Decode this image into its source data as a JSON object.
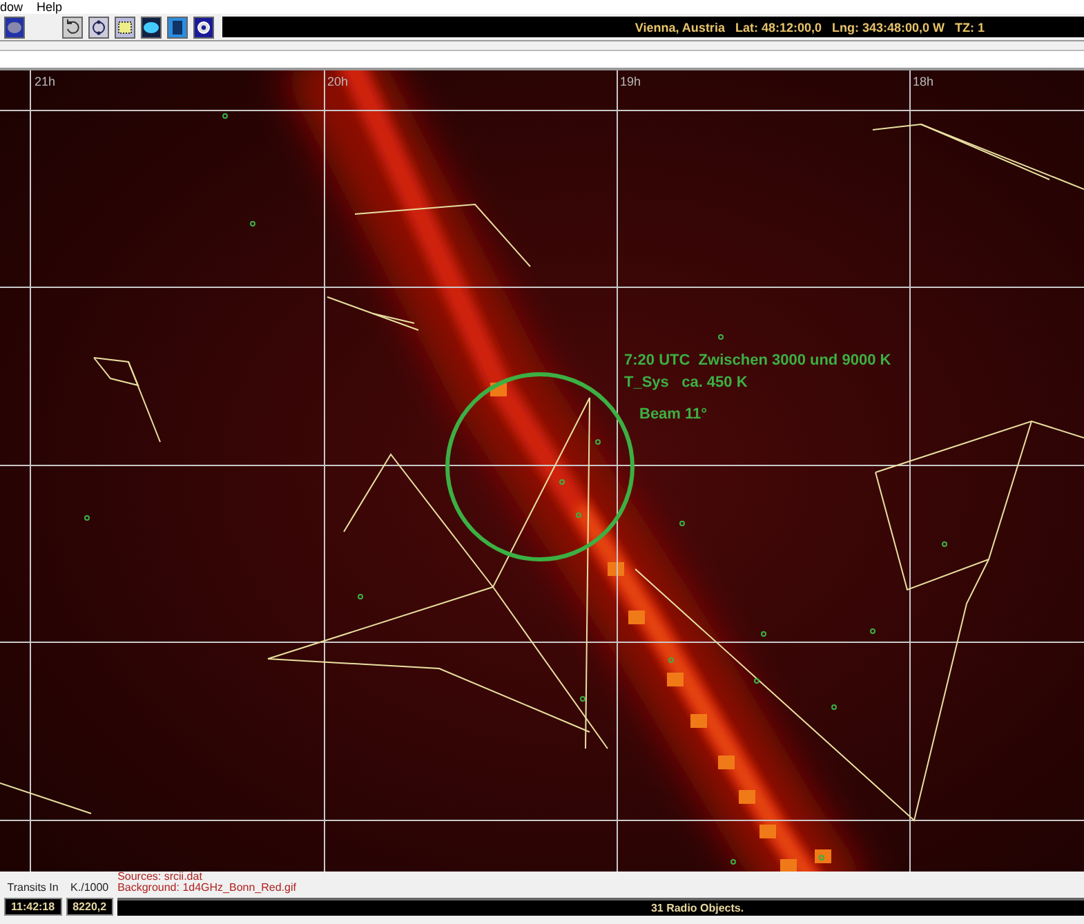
{
  "menu": [
    {
      "label": "dow"
    },
    {
      "label": "Help"
    }
  ],
  "toolbar": {
    "location": "Vienna, Austria   Lat: 48:12:00,0   Lng: 343:48:00,0 W   TZ: 1"
  },
  "sky_map": {
    "hour_labels": [
      "21h",
      "20h",
      "19h",
      "18h"
    ],
    "annotations": [
      "7:20 UTC  Zwischen 3000 und 9000 K",
      "T_Sys   ca. 450 K",
      "Beam 11°"
    ]
  },
  "footer": {
    "fields": [
      {
        "label": "Transits In",
        "value": "11:42:18"
      },
      {
        "label": "K./1000",
        "value": "8220,2"
      }
    ],
    "sources": "Sources: srcii.dat",
    "background": "Background: 1d4GHz_Bonn_Red.gif",
    "status": "31 Radio Objects."
  }
}
